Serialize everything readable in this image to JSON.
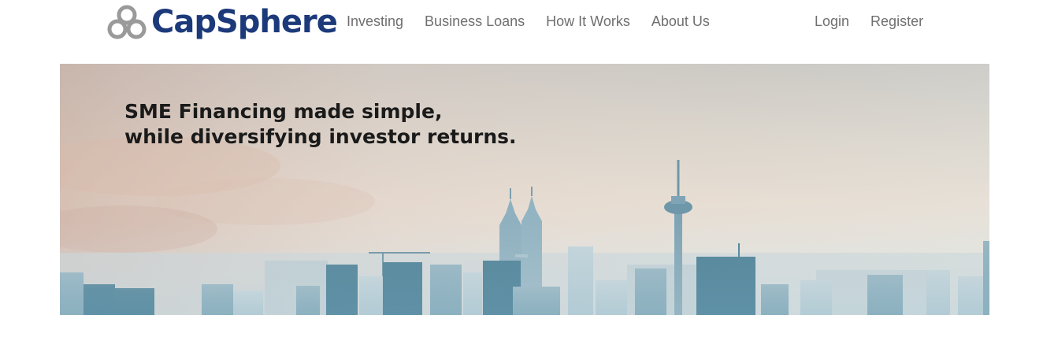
{
  "brand": {
    "name": "CapSphere",
    "color": "#1c3a7a",
    "icon": "trefoil-logo-icon"
  },
  "nav": {
    "items": [
      {
        "label": "Investing"
      },
      {
        "label": "Business Loans"
      },
      {
        "label": "How It Works"
      },
      {
        "label": "About Us"
      }
    ],
    "auth": {
      "login": "Login",
      "register": "Register"
    }
  },
  "hero": {
    "headline_line1": "SME Financing made simple,",
    "headline_line2": "while diversifying investor returns.",
    "image": "city-skyline-image"
  }
}
